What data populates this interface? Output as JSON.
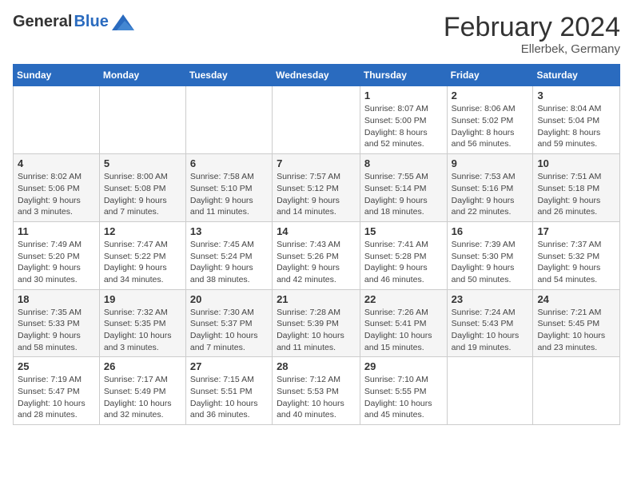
{
  "header": {
    "logo_general": "General",
    "logo_blue": "Blue",
    "month_year": "February 2024",
    "location": "Ellerbek, Germany"
  },
  "weekdays": [
    "Sunday",
    "Monday",
    "Tuesday",
    "Wednesday",
    "Thursday",
    "Friday",
    "Saturday"
  ],
  "weeks": [
    [
      {
        "day": "",
        "sunrise": "",
        "sunset": "",
        "daylight": ""
      },
      {
        "day": "",
        "sunrise": "",
        "sunset": "",
        "daylight": ""
      },
      {
        "day": "",
        "sunrise": "",
        "sunset": "",
        "daylight": ""
      },
      {
        "day": "",
        "sunrise": "",
        "sunset": "",
        "daylight": ""
      },
      {
        "day": "1",
        "sunrise": "Sunrise: 8:07 AM",
        "sunset": "Sunset: 5:00 PM",
        "daylight": "Daylight: 8 hours and 52 minutes."
      },
      {
        "day": "2",
        "sunrise": "Sunrise: 8:06 AM",
        "sunset": "Sunset: 5:02 PM",
        "daylight": "Daylight: 8 hours and 56 minutes."
      },
      {
        "day": "3",
        "sunrise": "Sunrise: 8:04 AM",
        "sunset": "Sunset: 5:04 PM",
        "daylight": "Daylight: 8 hours and 59 minutes."
      }
    ],
    [
      {
        "day": "4",
        "sunrise": "Sunrise: 8:02 AM",
        "sunset": "Sunset: 5:06 PM",
        "daylight": "Daylight: 9 hours and 3 minutes."
      },
      {
        "day": "5",
        "sunrise": "Sunrise: 8:00 AM",
        "sunset": "Sunset: 5:08 PM",
        "daylight": "Daylight: 9 hours and 7 minutes."
      },
      {
        "day": "6",
        "sunrise": "Sunrise: 7:58 AM",
        "sunset": "Sunset: 5:10 PM",
        "daylight": "Daylight: 9 hours and 11 minutes."
      },
      {
        "day": "7",
        "sunrise": "Sunrise: 7:57 AM",
        "sunset": "Sunset: 5:12 PM",
        "daylight": "Daylight: 9 hours and 14 minutes."
      },
      {
        "day": "8",
        "sunrise": "Sunrise: 7:55 AM",
        "sunset": "Sunset: 5:14 PM",
        "daylight": "Daylight: 9 hours and 18 minutes."
      },
      {
        "day": "9",
        "sunrise": "Sunrise: 7:53 AM",
        "sunset": "Sunset: 5:16 PM",
        "daylight": "Daylight: 9 hours and 22 minutes."
      },
      {
        "day": "10",
        "sunrise": "Sunrise: 7:51 AM",
        "sunset": "Sunset: 5:18 PM",
        "daylight": "Daylight: 9 hours and 26 minutes."
      }
    ],
    [
      {
        "day": "11",
        "sunrise": "Sunrise: 7:49 AM",
        "sunset": "Sunset: 5:20 PM",
        "daylight": "Daylight: 9 hours and 30 minutes."
      },
      {
        "day": "12",
        "sunrise": "Sunrise: 7:47 AM",
        "sunset": "Sunset: 5:22 PM",
        "daylight": "Daylight: 9 hours and 34 minutes."
      },
      {
        "day": "13",
        "sunrise": "Sunrise: 7:45 AM",
        "sunset": "Sunset: 5:24 PM",
        "daylight": "Daylight: 9 hours and 38 minutes."
      },
      {
        "day": "14",
        "sunrise": "Sunrise: 7:43 AM",
        "sunset": "Sunset: 5:26 PM",
        "daylight": "Daylight: 9 hours and 42 minutes."
      },
      {
        "day": "15",
        "sunrise": "Sunrise: 7:41 AM",
        "sunset": "Sunset: 5:28 PM",
        "daylight": "Daylight: 9 hours and 46 minutes."
      },
      {
        "day": "16",
        "sunrise": "Sunrise: 7:39 AM",
        "sunset": "Sunset: 5:30 PM",
        "daylight": "Daylight: 9 hours and 50 minutes."
      },
      {
        "day": "17",
        "sunrise": "Sunrise: 7:37 AM",
        "sunset": "Sunset: 5:32 PM",
        "daylight": "Daylight: 9 hours and 54 minutes."
      }
    ],
    [
      {
        "day": "18",
        "sunrise": "Sunrise: 7:35 AM",
        "sunset": "Sunset: 5:33 PM",
        "daylight": "Daylight: 9 hours and 58 minutes."
      },
      {
        "day": "19",
        "sunrise": "Sunrise: 7:32 AM",
        "sunset": "Sunset: 5:35 PM",
        "daylight": "Daylight: 10 hours and 3 minutes."
      },
      {
        "day": "20",
        "sunrise": "Sunrise: 7:30 AM",
        "sunset": "Sunset: 5:37 PM",
        "daylight": "Daylight: 10 hours and 7 minutes."
      },
      {
        "day": "21",
        "sunrise": "Sunrise: 7:28 AM",
        "sunset": "Sunset: 5:39 PM",
        "daylight": "Daylight: 10 hours and 11 minutes."
      },
      {
        "day": "22",
        "sunrise": "Sunrise: 7:26 AM",
        "sunset": "Sunset: 5:41 PM",
        "daylight": "Daylight: 10 hours and 15 minutes."
      },
      {
        "day": "23",
        "sunrise": "Sunrise: 7:24 AM",
        "sunset": "Sunset: 5:43 PM",
        "daylight": "Daylight: 10 hours and 19 minutes."
      },
      {
        "day": "24",
        "sunrise": "Sunrise: 7:21 AM",
        "sunset": "Sunset: 5:45 PM",
        "daylight": "Daylight: 10 hours and 23 minutes."
      }
    ],
    [
      {
        "day": "25",
        "sunrise": "Sunrise: 7:19 AM",
        "sunset": "Sunset: 5:47 PM",
        "daylight": "Daylight: 10 hours and 28 minutes."
      },
      {
        "day": "26",
        "sunrise": "Sunrise: 7:17 AM",
        "sunset": "Sunset: 5:49 PM",
        "daylight": "Daylight: 10 hours and 32 minutes."
      },
      {
        "day": "27",
        "sunrise": "Sunrise: 7:15 AM",
        "sunset": "Sunset: 5:51 PM",
        "daylight": "Daylight: 10 hours and 36 minutes."
      },
      {
        "day": "28",
        "sunrise": "Sunrise: 7:12 AM",
        "sunset": "Sunset: 5:53 PM",
        "daylight": "Daylight: 10 hours and 40 minutes."
      },
      {
        "day": "29",
        "sunrise": "Sunrise: 7:10 AM",
        "sunset": "Sunset: 5:55 PM",
        "daylight": "Daylight: 10 hours and 45 minutes."
      },
      {
        "day": "",
        "sunrise": "",
        "sunset": "",
        "daylight": ""
      },
      {
        "day": "",
        "sunrise": "",
        "sunset": "",
        "daylight": ""
      }
    ]
  ]
}
